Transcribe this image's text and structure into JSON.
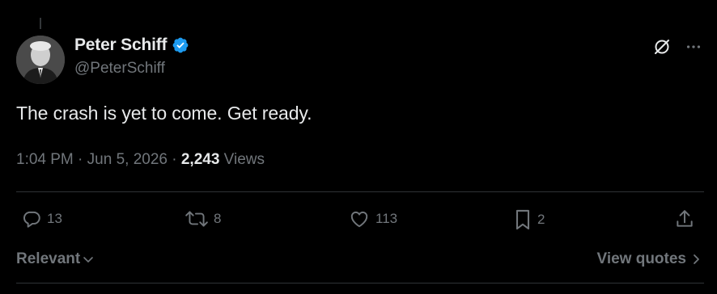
{
  "author": {
    "display_name": "Peter Schiff",
    "handle": "@PeterSchiff",
    "verified": true,
    "verified_color": "#1d9bf0"
  },
  "tweet": {
    "text": "The crash is yet to come. Get ready.",
    "time": "1:04 PM",
    "date": "Jun 5, 2026",
    "separator": " · ",
    "views_count": "2,243",
    "views_label": " Views"
  },
  "actions": {
    "reply_count": "13",
    "retweet_count": "8",
    "like_count": "113",
    "bookmark_count": "2"
  },
  "footer": {
    "sort_label": "Relevant",
    "view_quotes_label": "View quotes"
  },
  "colors": {
    "background": "#000000",
    "text_primary": "#e7e9ea",
    "text_secondary": "#71767b",
    "divider": "#2f3336"
  },
  "icons": {
    "top_right": [
      "grok-icon",
      "more-icon"
    ],
    "action_bar": [
      "reply-icon",
      "retweet-icon",
      "like-icon",
      "bookmark-icon",
      "share-icon"
    ]
  }
}
